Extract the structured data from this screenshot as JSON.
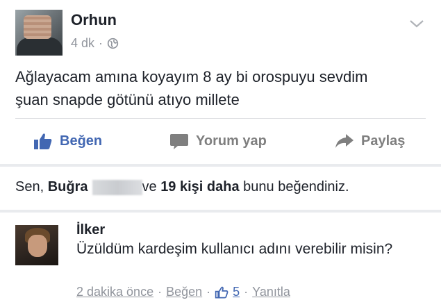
{
  "post": {
    "author": "Orhun",
    "time": "4 dk",
    "dot": "·",
    "privacy_icon": "globe-icon",
    "text_lines": [
      "Ağlayacam amına koyayım 8 ay bi orospuyu sevdim",
      "şuan snapde götünü atıyo millete"
    ]
  },
  "actions": {
    "like": "Beğen",
    "comment": "Yorum yap",
    "share": "Paylaş"
  },
  "likes": {
    "prefix": "Sen, ",
    "name": "Buğra",
    "middle": "ve ",
    "others": "19 kişi daha",
    "suffix": " bunu beğendiniz."
  },
  "comment": {
    "author": "İlker",
    "text": "Üzüldüm kardeşim kullanıcı adını verebilir misin?",
    "time": "2 dakika önce",
    "sep": "·",
    "like": "Beğen",
    "like_count": "5",
    "reply": "Yanıtla"
  },
  "colors": {
    "link_blue": "#4267b2",
    "meta_gray": "#90949c",
    "action_gray": "#7f7f7f"
  }
}
